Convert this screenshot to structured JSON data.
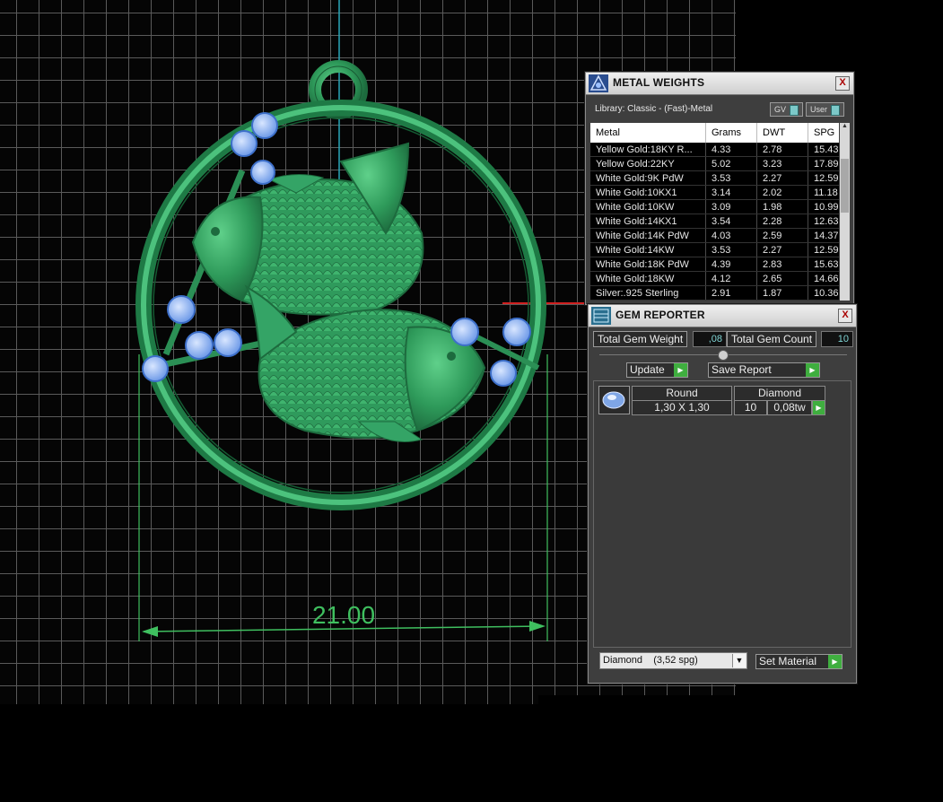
{
  "viewport": {
    "dimension_label": "21.00",
    "colors": {
      "metal": "#2e8b57",
      "gem": "#8fb8ff",
      "dimension": "#3fbf5f",
      "grid": "#5a5a5a"
    }
  },
  "metal_weights": {
    "title": "METAL WEIGHTS",
    "close_label": "X",
    "library_label": "Library: Classic - (Fast)-Metal",
    "gv_label": "GV",
    "user_label": "User",
    "columns": [
      "Metal",
      "Grams",
      "DWT",
      "SPG"
    ],
    "rows": [
      {
        "metal": "Yellow Gold:18KY R...",
        "grams": "4.33",
        "dwt": "2.78",
        "spg": "15.43"
      },
      {
        "metal": "Yellow Gold:22KY",
        "grams": "5.02",
        "dwt": "3.23",
        "spg": "17.89"
      },
      {
        "metal": "White Gold:9K PdW",
        "grams": "3.53",
        "dwt": "2.27",
        "spg": "12.59"
      },
      {
        "metal": "White Gold:10KX1",
        "grams": "3.14",
        "dwt": "2.02",
        "spg": "11.18"
      },
      {
        "metal": "White Gold:10KW",
        "grams": "3.09",
        "dwt": "1.98",
        "spg": "10.99"
      },
      {
        "metal": "White Gold:14KX1",
        "grams": "3.54",
        "dwt": "2.28",
        "spg": "12.63"
      },
      {
        "metal": "White Gold:14K PdW",
        "grams": "4.03",
        "dwt": "2.59",
        "spg": "14.37"
      },
      {
        "metal": "White Gold:14KW",
        "grams": "3.53",
        "dwt": "2.27",
        "spg": "12.59"
      },
      {
        "metal": "White Gold:18K PdW",
        "grams": "4.39",
        "dwt": "2.83",
        "spg": "15.63"
      },
      {
        "metal": "White Gold:18KW",
        "grams": "4.12",
        "dwt": "2.65",
        "spg": "14.66"
      },
      {
        "metal": "Silver:.925 Sterling",
        "grams": "2.91",
        "dwt": "1.87",
        "spg": "10.36"
      }
    ]
  },
  "gem_reporter": {
    "title": "GEM REPORTER",
    "close_label": "X",
    "total_weight_label": "Total Gem Weight",
    "total_weight_value": ",08",
    "total_count_label": "Total Gem Count",
    "total_count_value": "10",
    "update_label": "Update",
    "save_report_label": "Save Report",
    "gems": [
      {
        "shape": "Round",
        "material": "Diamond",
        "size": "1,30 X 1,30",
        "count": "10",
        "weight": "0,08tw"
      }
    ],
    "material_select": "Diamond    (3,52 spg)",
    "set_material_label": "Set Material"
  }
}
